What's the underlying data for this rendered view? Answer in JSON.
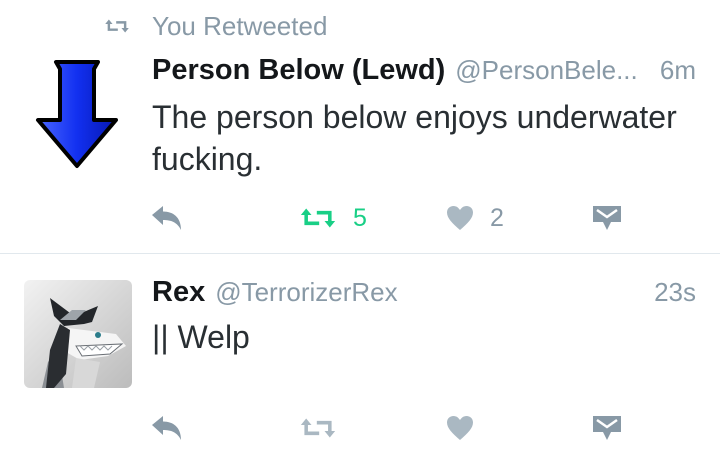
{
  "colors": {
    "icon_gray": "#8899a6",
    "icon_light_gray": "#aab8c2",
    "retweet_green": "#19cf86",
    "arrow_blue": "#0a22d8",
    "divider": "#e1e8ed"
  },
  "tweets": [
    {
      "context_icon": "retweet-icon",
      "context": "You Retweeted",
      "avatar_icon": "blue-down-arrow",
      "name": "Person Below (Lewd)",
      "handle": "@PersonBele...",
      "time": "6m",
      "text": "The person below enjoys underwater fucking.",
      "actions": {
        "reply_icon": "reply-icon",
        "retweet_icon": "retweet-icon",
        "retweet_count": "5",
        "retweeted": true,
        "like_icon": "heart-icon",
        "like_count": "2",
        "message_icon": "direct-message-icon"
      }
    },
    {
      "avatar_icon": "shark-character-avatar",
      "name": "Rex",
      "handle": "@TerrorizerRex",
      "time": "23s",
      "text": "|| Welp",
      "actions": {
        "reply_icon": "reply-icon",
        "retweet_icon": "retweet-icon",
        "retweeted": false,
        "like_icon": "heart-icon",
        "message_icon": "direct-message-icon"
      }
    }
  ]
}
